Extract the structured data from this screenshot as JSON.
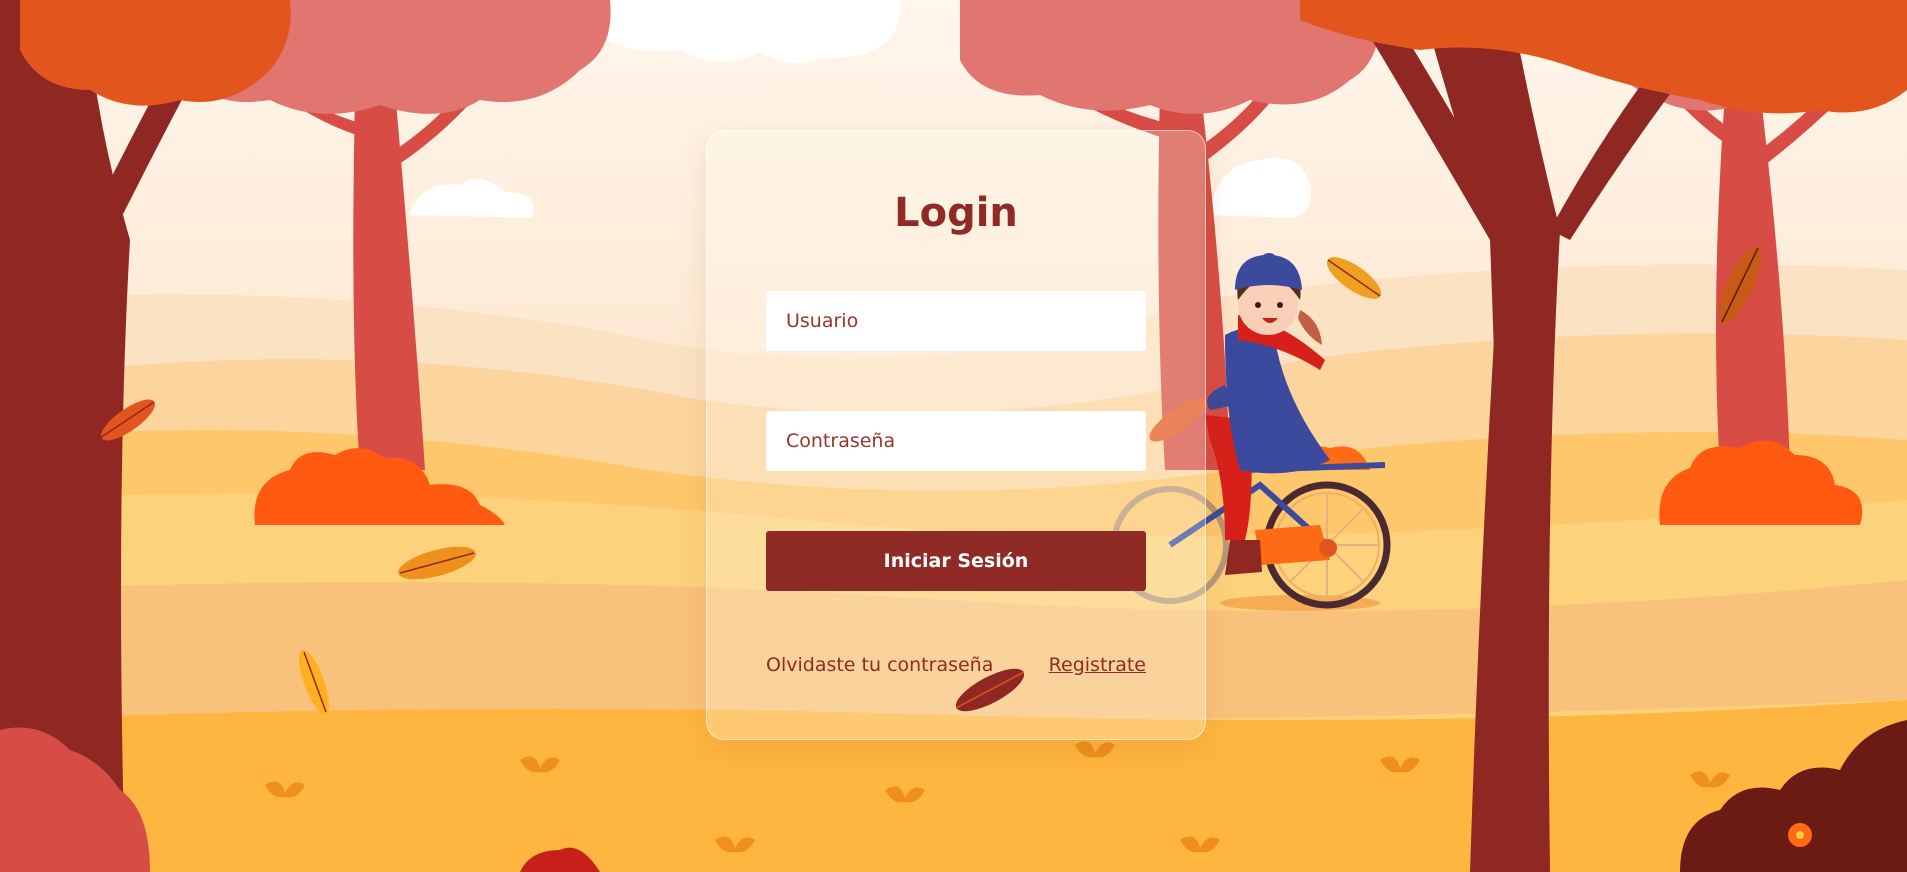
{
  "login": {
    "title": "Login",
    "username_placeholder": "Usuario",
    "password_placeholder": "Contraseña",
    "submit_label": "Iniciar Sesión",
    "forgot_label": "Olvidaste tu contraseña",
    "register_label": "Registrate"
  },
  "colors": {
    "accent": "#8f2b24",
    "sky": "#fdebd6",
    "ground": "#ffb640",
    "tree_trunk": "#8f2722",
    "foliage_pink": "#e17570",
    "foliage_orange": "#e2561e"
  }
}
